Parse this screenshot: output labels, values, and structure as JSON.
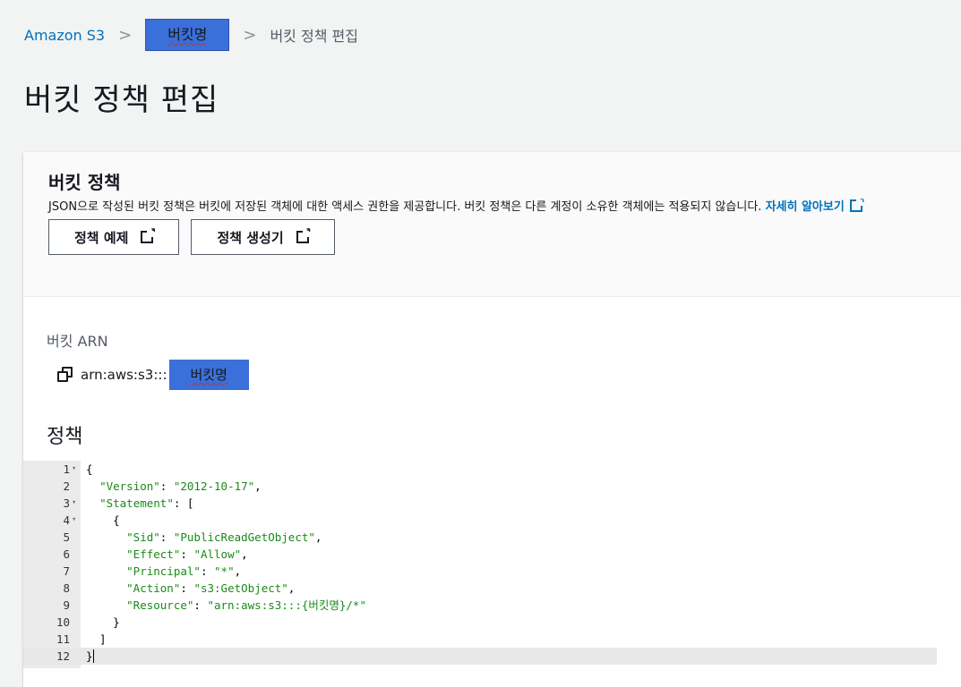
{
  "breadcrumb": {
    "root": "Amazon S3",
    "bucket": "버킷명",
    "current": "버킷 정책 편집"
  },
  "page_title": "버킷 정책 편집",
  "panel": {
    "title": "버킷 정책",
    "description": "JSON으로 작성된 버킷 정책은 버킷에 저장된 객체에 대한 액세스 권한을 제공합니다. 버킷 정책은 다른 계정이 소유한 객체에는 적용되지 않습니다.",
    "learn_more": "자세히 알아보기",
    "buttons": [
      "정책 예제",
      "정책 생성기"
    ]
  },
  "arn": {
    "label": "버킷 ARN",
    "prefix": "arn:aws:s3:::",
    "bucket": "버킷명"
  },
  "policy": {
    "heading": "정책",
    "lines": [
      {
        "n": "1",
        "fold": true,
        "text": "{"
      },
      {
        "n": "2",
        "fold": false,
        "text": "  \"Version\": \"2012-10-17\","
      },
      {
        "n": "3",
        "fold": true,
        "text": "  \"Statement\": ["
      },
      {
        "n": "4",
        "fold": true,
        "text": "    {"
      },
      {
        "n": "5",
        "fold": false,
        "text": "      \"Sid\": \"PublicReadGetObject\","
      },
      {
        "n": "6",
        "fold": false,
        "text": "      \"Effect\": \"Allow\","
      },
      {
        "n": "7",
        "fold": false,
        "text": "      \"Principal\": \"*\","
      },
      {
        "n": "8",
        "fold": false,
        "text": "      \"Action\": \"s3:GetObject\","
      },
      {
        "n": "9",
        "fold": false,
        "text": "      \"Resource\": \"arn:aws:s3:::{버킷명}/*\""
      },
      {
        "n": "10",
        "fold": false,
        "text": "    }"
      },
      {
        "n": "11",
        "fold": false,
        "text": "  ]"
      },
      {
        "n": "12",
        "fold": false,
        "text": "}"
      }
    ]
  },
  "colors": {
    "link": "#0073bb",
    "highlight": "#3b6fd9",
    "json_string": "#1a8a1a"
  }
}
